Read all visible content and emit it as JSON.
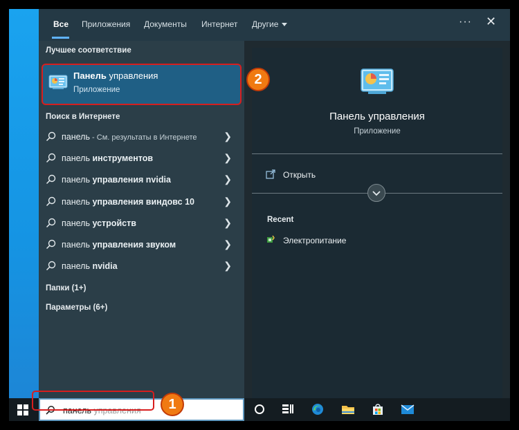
{
  "tabs": [
    {
      "label": "Все",
      "active": true
    },
    {
      "label": "Приложения"
    },
    {
      "label": "Документы"
    },
    {
      "label": "Интернет"
    },
    {
      "label": "Другие"
    }
  ],
  "top_icons": [
    "more-icon",
    "close-icon"
  ],
  "best_match": {
    "section_label": "Лучшее соответствие",
    "title_bold": "Панель",
    "title_rest": " управления",
    "subtitle": "Приложение"
  },
  "web_search": {
    "section_label": "Поиск в Интернете",
    "items": [
      {
        "prefix": "панель",
        "bold": "",
        "suffix": " - См. результаты в Интернете"
      },
      {
        "prefix": "панель ",
        "bold": "инструментов",
        "suffix": ""
      },
      {
        "prefix": "панель ",
        "bold": "управления nvidia",
        "suffix": ""
      },
      {
        "prefix": "панель ",
        "bold": "управления виндовс 10",
        "suffix": ""
      },
      {
        "prefix": "панель ",
        "bold": "устройств",
        "suffix": ""
      },
      {
        "prefix": "панель ",
        "bold": "управления звуком",
        "suffix": ""
      },
      {
        "prefix": "панель ",
        "bold": "nvidia",
        "suffix": ""
      }
    ]
  },
  "groups": [
    "Папки (1+)",
    "Параметры (6+)"
  ],
  "preview": {
    "title": "Панель управления",
    "subtitle": "Приложение",
    "open_label": "Открыть",
    "recent_label": "Recent",
    "recent_items": [
      "Электропитание"
    ]
  },
  "search": {
    "typed": "панель",
    "placeholder_rest": " управления"
  },
  "annotations": [
    "1",
    "2"
  ],
  "taskbar_icons": [
    "windows-start-icon",
    "cortana-icon",
    "task-view-icon",
    "edge-icon",
    "file-explorer-icon",
    "store-icon",
    "mail-icon"
  ],
  "colors": {
    "accent": "#60b3ff",
    "selected": "#1f5f85",
    "highlight_border": "#d81e1e",
    "badge": "#f07a12"
  }
}
